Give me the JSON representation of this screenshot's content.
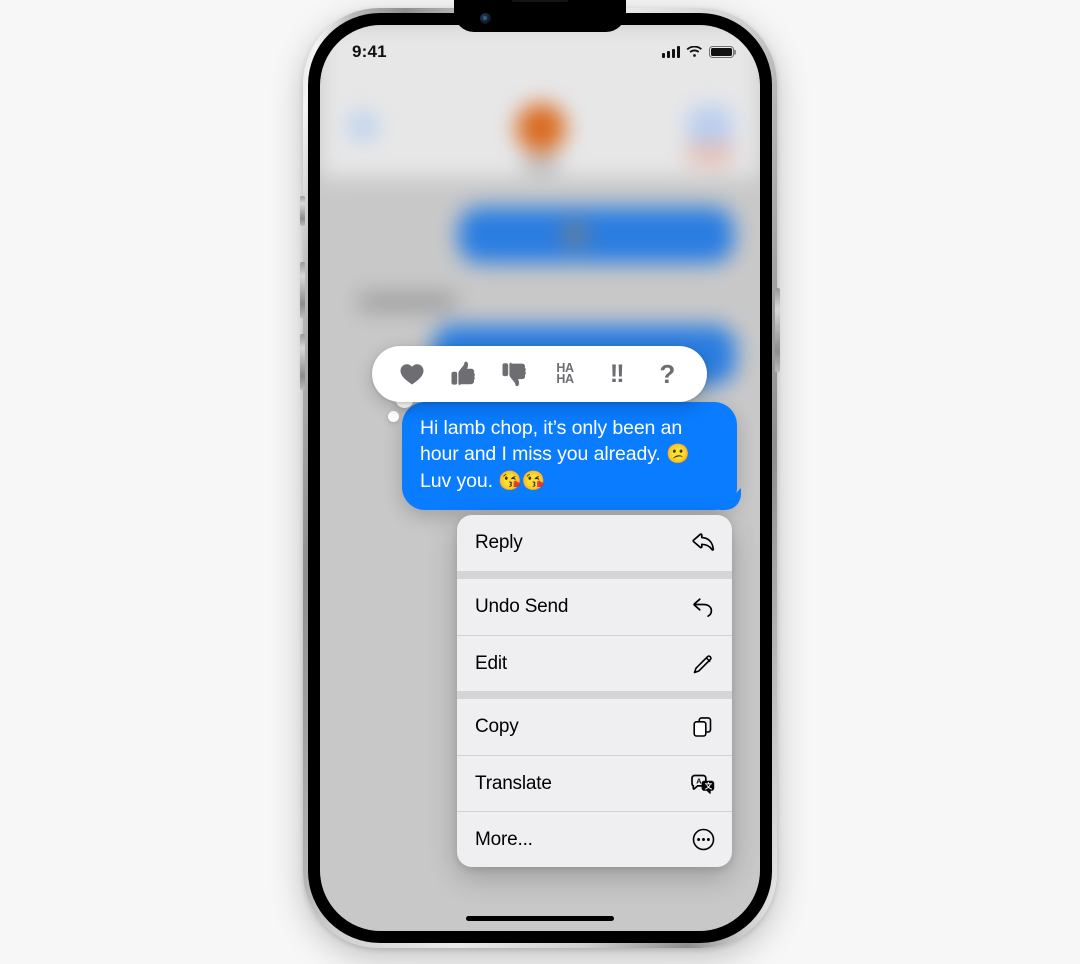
{
  "device": {
    "name": "iphone-14-pro",
    "frame_color": "#c9c9c9"
  },
  "status_bar": {
    "time": "9:41",
    "cellular_icon": "signal-bars-icon",
    "cellular_bars": 4,
    "wifi_icon": "wifi-icon",
    "battery_icon": "battery-icon",
    "battery_level": 100
  },
  "conversation": {
    "background_color": "#c8c8c8",
    "blurred": true,
    "nav_bar": {
      "back_icon": "back-chevron-icon",
      "avatar": "contact-avatar",
      "avatar_color": "#d96b20",
      "action_icon": "facetime-icon"
    }
  },
  "tapback": {
    "name": "tapback-reaction-bar",
    "background_color": "#ffffff",
    "options": [
      {
        "id": "heart",
        "icon": "heart-icon",
        "label": "Love"
      },
      {
        "id": "thumbsup",
        "icon": "thumbs-up-icon",
        "label": "Like"
      },
      {
        "id": "thumbsdown",
        "icon": "thumbs-down-icon",
        "label": "Dislike"
      },
      {
        "id": "haha",
        "icon": "haha-icon",
        "label": "HA HA",
        "line1": "HA",
        "line2": "HA"
      },
      {
        "id": "exclaim",
        "icon": "exclamation-icon",
        "label": "!!",
        "glyph": "!!"
      },
      {
        "id": "question",
        "icon": "question-mark-icon",
        "label": "?",
        "glyph": "?"
      }
    ]
  },
  "focused_message": {
    "name": "outgoing-message-bubble",
    "direction": "outgoing",
    "bubble_color": "#0a7cff",
    "text_color": "#ffffff",
    "line1": "Hi lamb chop, it’s only been an",
    "line2_text": "hour and I miss you already. ",
    "line2_emoji": "😕",
    "line3_text": "Luv you. ",
    "line3_emoji": "😘😘",
    "full_text": "Hi lamb chop, it’s only been an hour and I miss you already. 😕 Luv you. 😘😘"
  },
  "context_menu": {
    "name": "message-context-menu",
    "background_color": "#efeff1",
    "groups": [
      {
        "items": [
          {
            "label": "Reply",
            "icon": "reply-arrow-icon"
          }
        ]
      },
      {
        "items": [
          {
            "label": "Undo Send",
            "icon": "undo-arrow-icon"
          },
          {
            "label": "Edit",
            "icon": "pencil-icon"
          }
        ]
      },
      {
        "items": [
          {
            "label": "Copy",
            "icon": "copy-documents-icon"
          },
          {
            "label": "Translate",
            "icon": "translate-bubbles-icon"
          },
          {
            "label": "More...",
            "icon": "ellipsis-circle-icon"
          }
        ]
      }
    ]
  },
  "home_indicator": {
    "name": "home-indicator"
  }
}
